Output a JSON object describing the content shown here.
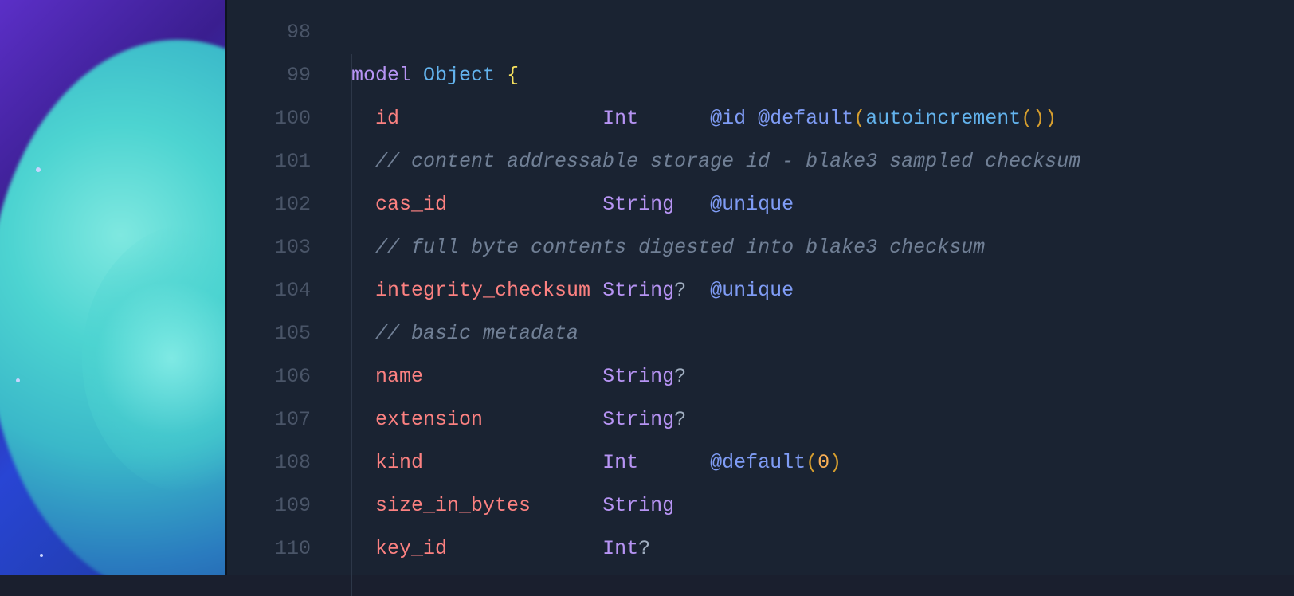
{
  "gutter": {
    "lines": [
      "98",
      "99",
      "100",
      "101",
      "102",
      "103",
      "104",
      "105",
      "106",
      "107",
      "108",
      "109",
      "110"
    ]
  },
  "code": {
    "l99": {
      "keyword": "model",
      "type": "Object",
      "brace": "{"
    },
    "l100": {
      "field": "id",
      "fieldtype": "Int",
      "attr1": "@id",
      "attr2": "@default",
      "paren1": "(",
      "func": "autoincrement",
      "paren2": "(",
      "paren3": ")",
      "paren4": ")"
    },
    "l101": {
      "comment": "// content addressable storage id - blake3 sampled checksum"
    },
    "l102": {
      "field": "cas_id",
      "fieldtype": "String",
      "attr": "@unique"
    },
    "l103": {
      "comment": "// full byte contents digested into blake3 checksum"
    },
    "l104": {
      "field": "integrity_checksum",
      "fieldtype": "String",
      "optional": "?",
      "attr": "@unique"
    },
    "l105": {
      "comment": "// basic metadata"
    },
    "l106": {
      "field": "name",
      "fieldtype": "String",
      "optional": "?"
    },
    "l107": {
      "field": "extension",
      "fieldtype": "String",
      "optional": "?"
    },
    "l108": {
      "field": "kind",
      "fieldtype": "Int",
      "attr": "@default",
      "paren1": "(",
      "num": "0",
      "paren2": ")"
    },
    "l109": {
      "field": "size_in_bytes",
      "fieldtype": "String"
    },
    "l110": {
      "field": "key_id",
      "fieldtype": "Int",
      "optional": "?"
    }
  }
}
